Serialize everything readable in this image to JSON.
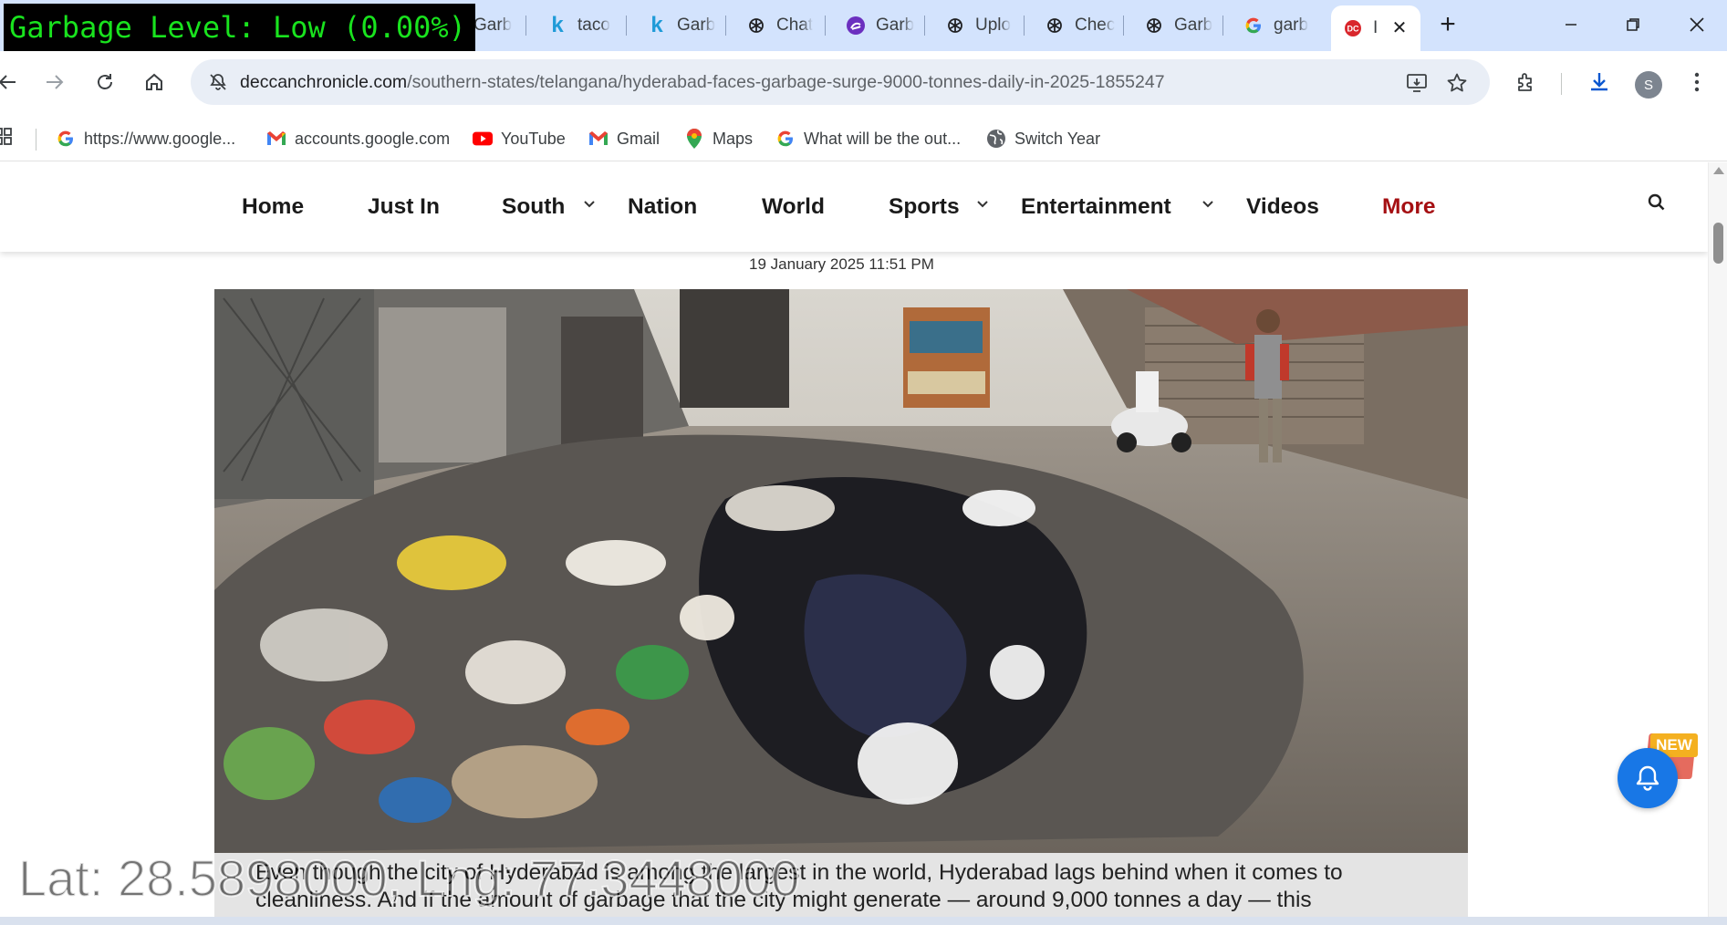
{
  "overlay": {
    "garbage_level": "Garbage Level: Low (0.00%)",
    "coordinates": "Lat: 28.5898000, Lng: 77.3448000"
  },
  "tabs": [
    {
      "title": "Garb",
      "icon": "generic-icon",
      "active": false
    },
    {
      "title": "taco",
      "icon": "k-icon",
      "active": false
    },
    {
      "title": "Garb",
      "icon": "k-icon",
      "active": false
    },
    {
      "title": "Chat",
      "icon": "openai-icon",
      "active": false
    },
    {
      "title": "Garb",
      "icon": "purple-swirl-icon",
      "active": false
    },
    {
      "title": "Uplo",
      "icon": "openai-icon",
      "active": false
    },
    {
      "title": "Chec",
      "icon": "openai-icon",
      "active": false
    },
    {
      "title": "Garb",
      "icon": "openai-icon",
      "active": false
    },
    {
      "title": "garb",
      "icon": "google-icon",
      "active": false
    },
    {
      "title": "I",
      "icon": "deccan-chronicle-icon",
      "active": true
    }
  ],
  "address_bar": {
    "domain": "deccanchronicle.com",
    "path": "/southern-states/telangana/hyderabad-faces-garbage-surge-9000-tonnes-daily-in-2025-1855247"
  },
  "profile": {
    "initial": "S"
  },
  "bookmarks": [
    {
      "label": "https://www.google...",
      "icon": "google-icon"
    },
    {
      "label": "accounts.google.com",
      "icon": "gmail-icon"
    },
    {
      "label": "YouTube",
      "icon": "youtube-icon"
    },
    {
      "label": "Gmail",
      "icon": "gmail-icon"
    },
    {
      "label": "Maps",
      "icon": "maps-icon"
    },
    {
      "label": "What will be the out...",
      "icon": "google-icon"
    },
    {
      "label": "Switch Year",
      "icon": "globe-icon"
    }
  ],
  "site_nav": {
    "items": [
      "Home",
      "Just In",
      "South",
      "Nation",
      "World",
      "Sports",
      "Entertainment",
      "Videos",
      "More"
    ]
  },
  "article": {
    "date": "19 January 2025 11:51 PM",
    "caption_line1": "Even though the city of Hyderabad is among the largest in the world, Hyderabad lags behind when it comes to",
    "caption_line2": "cleanliness. And if the amount of garbage that the city might generate — around 9,000 tonnes a day — this",
    "photo_alt": "garbage-heap-street-photo"
  },
  "notification": {
    "badge": "NEW"
  },
  "colors": {
    "tab_strip": "#d3e3fd",
    "omnibox": "#e9eef6",
    "nav_more": "#a50f12",
    "bell": "#1877e6",
    "overlay_green": "#19e31e"
  }
}
